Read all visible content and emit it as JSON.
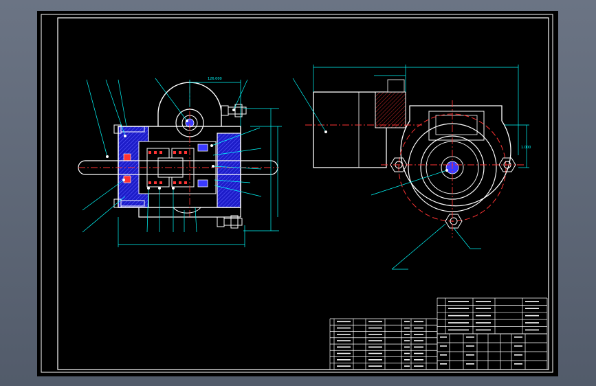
{
  "colors": {
    "background": "#000000",
    "frame": "#5d6676",
    "border": "#ffffff",
    "outline": "#ffffff",
    "dimension": "#00ffff",
    "centerline": "#ff3333",
    "hatch": "#3a3aff",
    "bolt": "#ffffff"
  },
  "drawing": {
    "left_view": {
      "top_dim_label": "126.000"
    },
    "right_view": {
      "dim_label": "1.000"
    }
  },
  "title_block": {
    "upper_table": {
      "rows": 5,
      "cols": 4
    },
    "main_table": {
      "rows": 8,
      "cols": 8
    }
  }
}
